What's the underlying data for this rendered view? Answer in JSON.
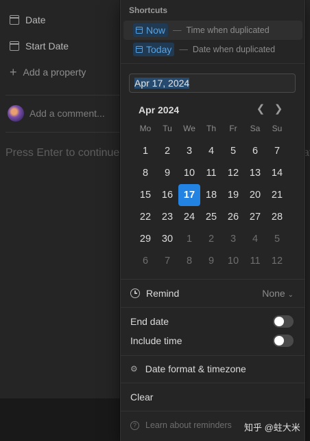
{
  "page": {
    "properties": [
      {
        "label": "Date",
        "icon": "calendar-icon"
      },
      {
        "label": "Start Date",
        "icon": "calendar-icon"
      }
    ],
    "add_property": "Add a property",
    "comment_placeholder": "Add a comment...",
    "body_placeholder": "Press Enter to continue",
    "body_placeholder_tail": "at"
  },
  "popup": {
    "shortcuts_title": "Shortcuts",
    "shortcuts": [
      {
        "label": "Now",
        "description": "Time when duplicated"
      },
      {
        "label": "Today",
        "description": "Date when duplicated"
      }
    ],
    "date_value": "Apr 17, 2024",
    "month_label": "Apr 2024",
    "weekdays": [
      "Mo",
      "Tu",
      "We",
      "Th",
      "Fr",
      "Sa",
      "Su"
    ],
    "days": [
      [
        "1",
        "2",
        "3",
        "4",
        "5",
        "6",
        "7"
      ],
      [
        "8",
        "9",
        "10",
        "11",
        "12",
        "13",
        "14"
      ],
      [
        "15",
        "16",
        "17",
        "18",
        "19",
        "20",
        "21"
      ],
      [
        "22",
        "23",
        "24",
        "25",
        "26",
        "27",
        "28"
      ],
      [
        "29",
        "30",
        "1",
        "2",
        "3",
        "4",
        "5"
      ],
      [
        "6",
        "7",
        "8",
        "9",
        "10",
        "11",
        "12"
      ]
    ],
    "selected_day": "17",
    "remind_label": "Remind",
    "remind_value": "None",
    "end_date_label": "End date",
    "end_date_on": false,
    "include_time_label": "Include time",
    "include_time_on": false,
    "date_format_label": "Date format & timezone",
    "clear_label": "Clear",
    "learn_label": "Learn about reminders"
  },
  "watermark": "知乎 @蛀大米",
  "colors": {
    "accent": "#2383e2",
    "shortcut_pill_bg": "#1f3a52",
    "shortcut_pill_text": "#5aa2e0"
  }
}
